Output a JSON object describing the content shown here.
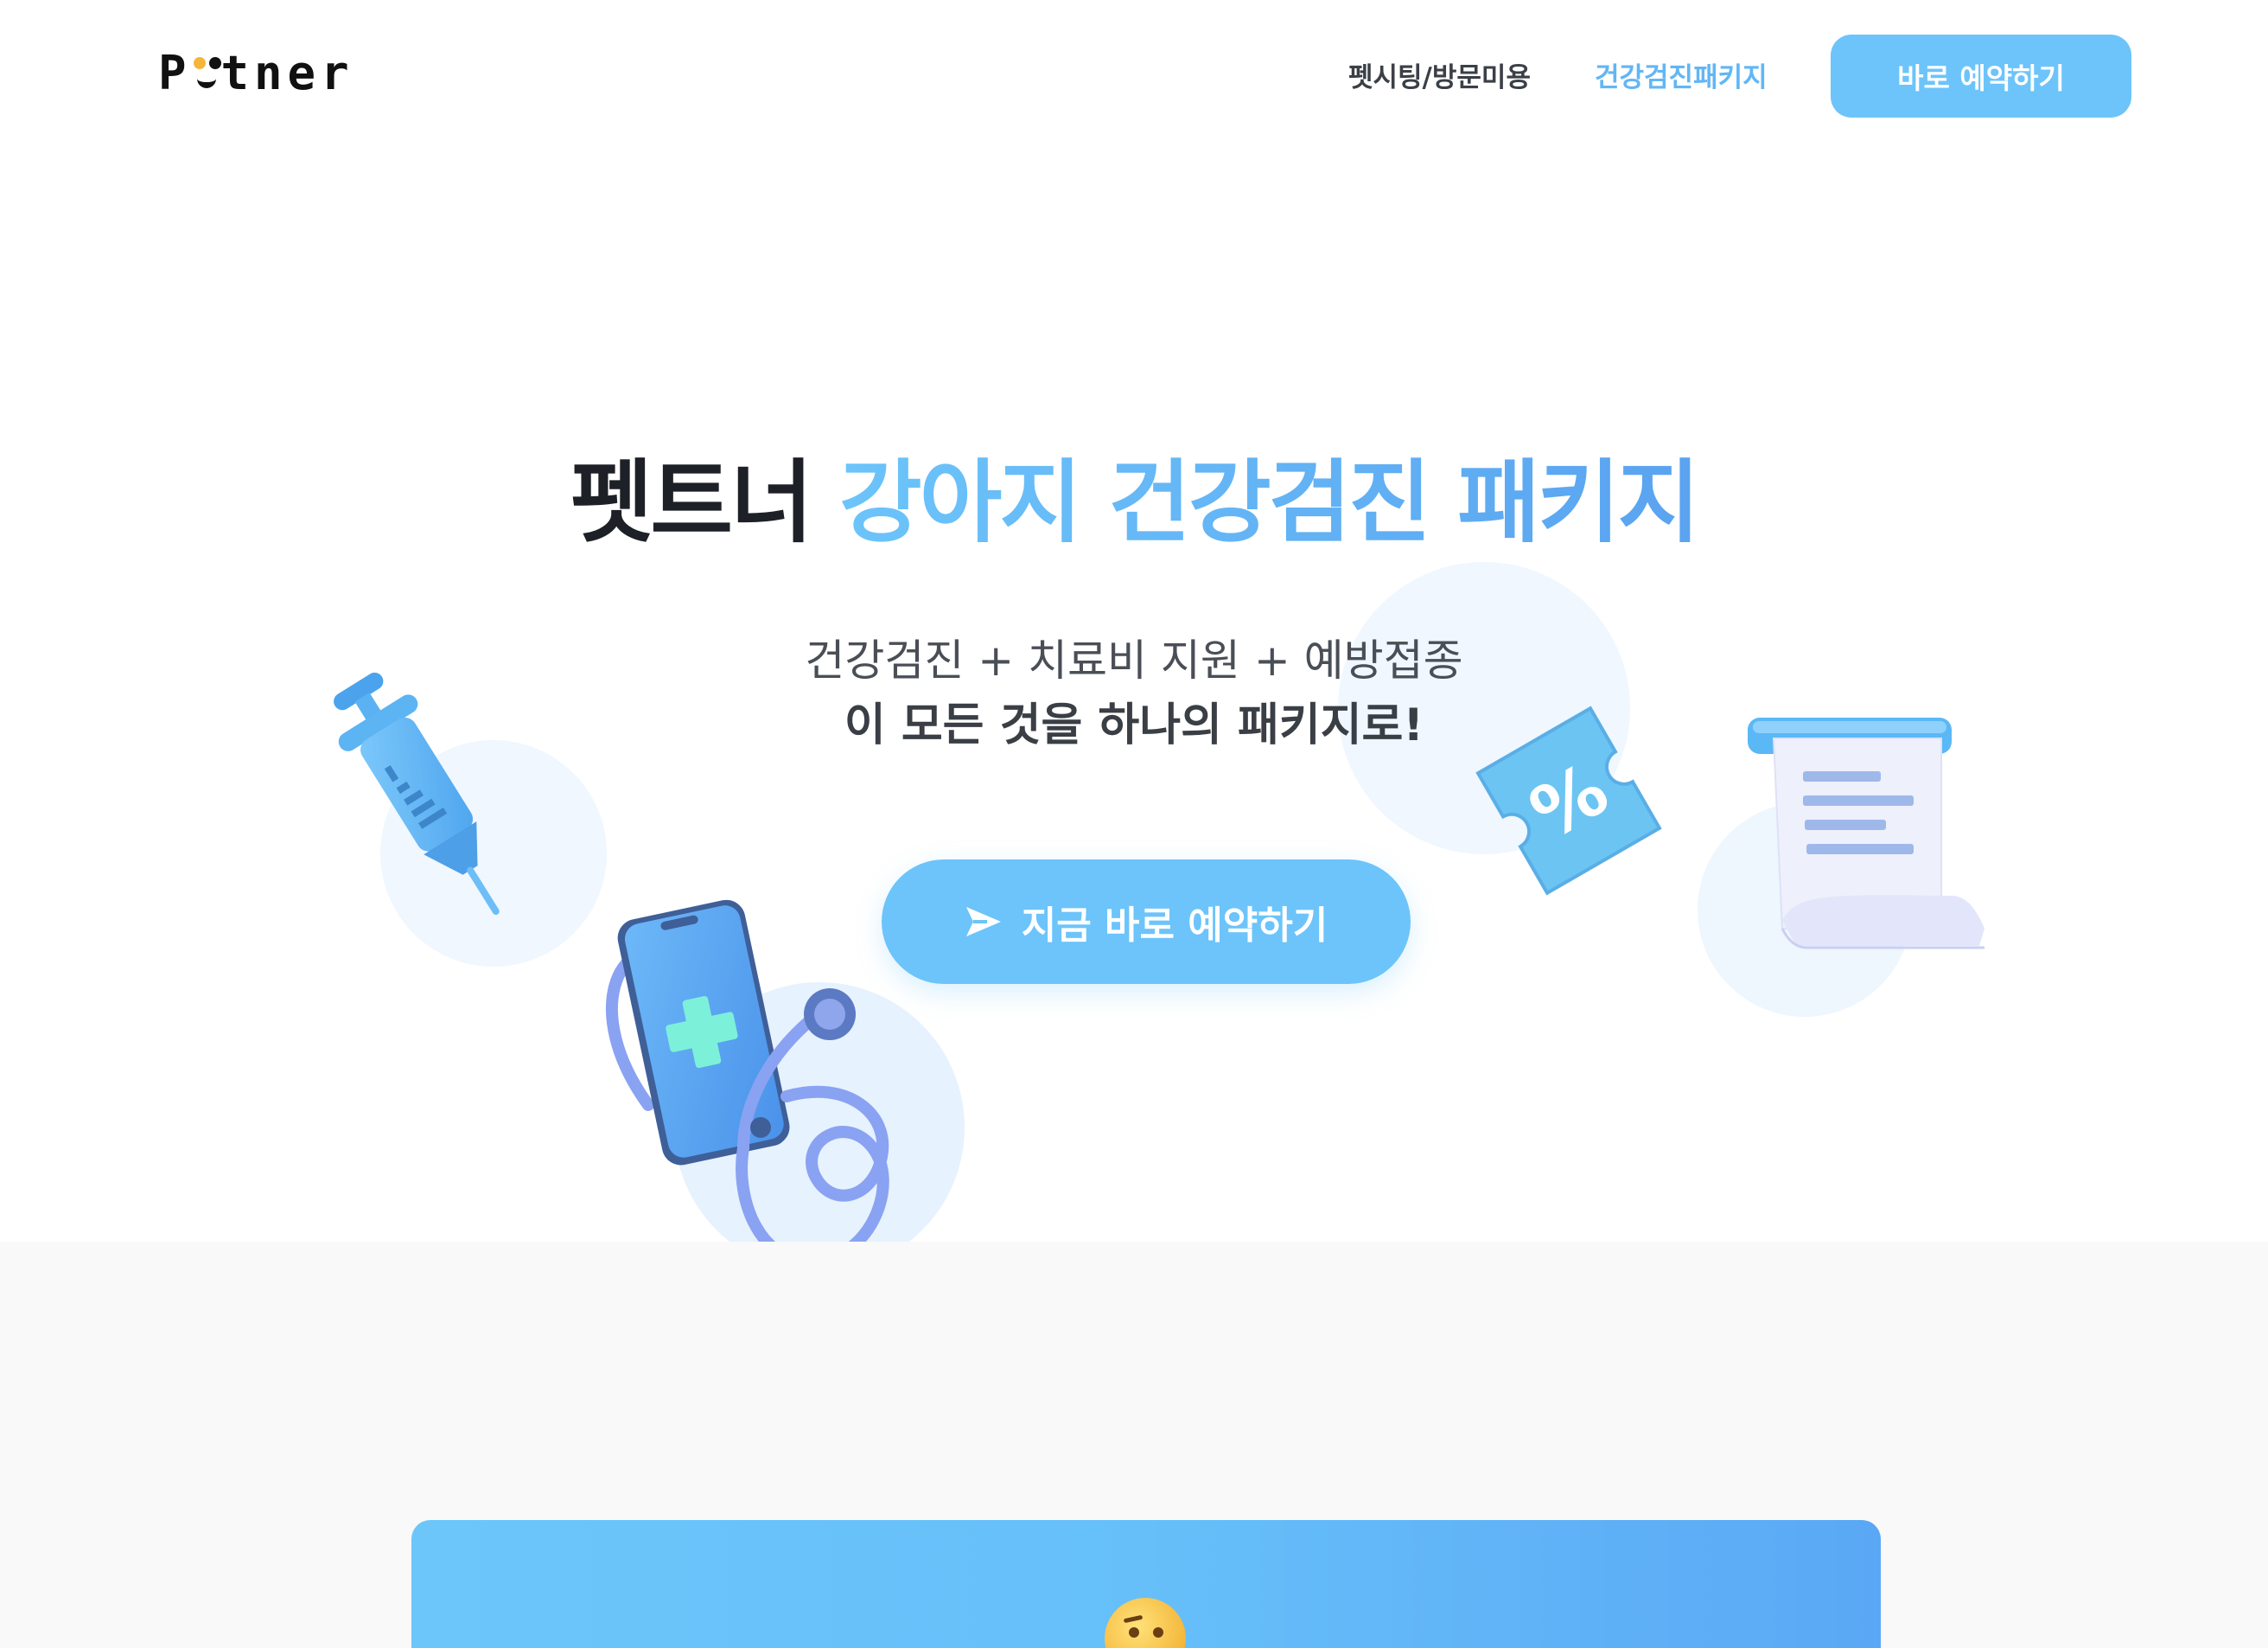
{
  "header": {
    "logo_text": "Petner",
    "logo_letters": [
      "P",
      "t",
      "n",
      "e",
      "r"
    ],
    "nav": [
      {
        "label": "펫시팅/방문미용",
        "active": false
      },
      {
        "label": "건강검진패키지",
        "active": true
      }
    ],
    "cta_label": "바로 예약하기"
  },
  "hero": {
    "title_dark": "펫트너",
    "title_blue": "강아지 건강검진 패키지",
    "subtitle_line1": "건강검진 + 치료비 지원 + 예방접종",
    "subtitle_line2": "이 모든 것을 하나의 패키지로!",
    "cta_label": "지금 바로 예약하기"
  },
  "illustrations": {
    "syringe": "syringe-icon",
    "phone_stethoscope": "phone-stethoscope-icon",
    "coupon": "percent-coupon-icon",
    "coupon_text": "%",
    "receipt": "receipt-icon"
  },
  "lower_card": {
    "emoji": "thinking-face-emoji"
  },
  "colors": {
    "accent": "#6cc4fa",
    "accent_dark": "#5aa3f0",
    "text_dark": "#1d2026",
    "section_bg": "#f9f9f9"
  }
}
